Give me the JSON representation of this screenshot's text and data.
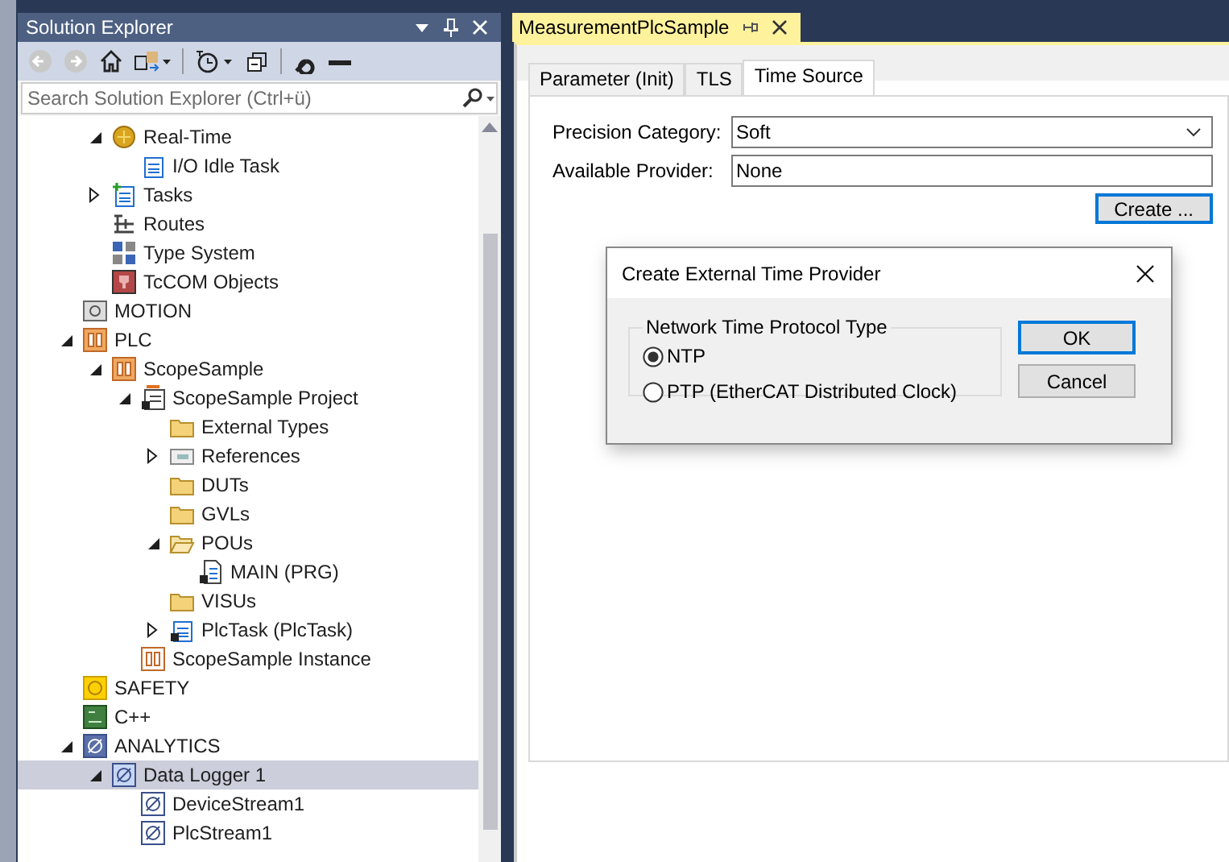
{
  "solution_explorer": {
    "title": "Solution Explorer",
    "search": {
      "placeholder": "Search Solution Explorer (Ctrl+ü)"
    },
    "tree": {
      "scrolled_items": [
        {
          "label": "Real-Time",
          "kind": "realtime",
          "expanded": true,
          "selected": false,
          "children": [
            {
              "label": "I/O Idle Task",
              "kind": "task",
              "selected": false
            }
          ]
        },
        {
          "label": "Tasks",
          "kind": "tasks",
          "expanded": false,
          "selected": false
        },
        {
          "label": "Routes",
          "kind": "routes",
          "selected": false
        },
        {
          "label": "Type System",
          "kind": "types",
          "selected": false
        },
        {
          "label": "TcCOM Objects",
          "kind": "tccom",
          "selected": false
        }
      ],
      "items": [
        {
          "label": "MOTION",
          "kind": "motion",
          "selected": false
        },
        {
          "label": "PLC",
          "kind": "plc",
          "expanded": true,
          "selected": false,
          "children": [
            {
              "label": "ScopeSample",
              "kind": "plc",
              "expanded": true,
              "selected": false,
              "children": [
                {
                  "label": "ScopeSample Project",
                  "kind": "project",
                  "expanded": true,
                  "selected": false,
                  "children": [
                    {
                      "label": "External Types",
                      "kind": "folder",
                      "selected": false
                    },
                    {
                      "label": "References",
                      "kind": "references",
                      "expanded": false,
                      "selected": false
                    },
                    {
                      "label": "DUTs",
                      "kind": "folder",
                      "selected": false
                    },
                    {
                      "label": "GVLs",
                      "kind": "folder",
                      "selected": false
                    },
                    {
                      "label": "POUs",
                      "kind": "folder-open",
                      "expanded": true,
                      "selected": false,
                      "children": [
                        {
                          "label": "MAIN (PRG)",
                          "kind": "pou",
                          "selected": false
                        }
                      ]
                    },
                    {
                      "label": "VISUs",
                      "kind": "folder",
                      "selected": false
                    },
                    {
                      "label": "PlcTask (PlcTask)",
                      "kind": "plctask",
                      "expanded": false,
                      "selected": false
                    }
                  ]
                },
                {
                  "label": "ScopeSample Instance",
                  "kind": "instance",
                  "selected": false
                }
              ]
            }
          ]
        },
        {
          "label": "SAFETY",
          "kind": "safety",
          "selected": false
        },
        {
          "label": "C++",
          "kind": "cpp",
          "selected": false
        },
        {
          "label": "ANALYTICS",
          "kind": "analytics",
          "expanded": true,
          "selected": false,
          "children": [
            {
              "label": "Data Logger 1",
              "kind": "logger",
              "expanded": true,
              "selected": true,
              "children": [
                {
                  "label": "DeviceStream1",
                  "kind": "stream",
                  "selected": false
                },
                {
                  "label": "PlcStream1",
                  "kind": "stream",
                  "selected": false
                }
              ]
            }
          ]
        }
      ]
    }
  },
  "document": {
    "tab": {
      "label": "MeasurementPlcSample",
      "selected": true
    },
    "tabs": [
      {
        "label": "Parameter (Init)",
        "selected": false
      },
      {
        "label": "TLS",
        "selected": false
      },
      {
        "label": "Time Source",
        "selected": true
      }
    ],
    "fields": [
      {
        "label": "Precision Category:",
        "value": "Soft",
        "kind": "combo"
      },
      {
        "label": "Available Provider:",
        "value": "None",
        "kind": "text"
      }
    ],
    "create_button": "Create ..."
  },
  "dialog": {
    "title": "Create External Time Provider",
    "group": "Network Time Protocol Type",
    "options": [
      {
        "label": "NTP",
        "selected": true
      },
      {
        "label": "PTP (EtherCAT Distributed Clock)",
        "selected": false
      }
    ],
    "buttons": [
      {
        "label": "OK",
        "default": true
      },
      {
        "label": "Cancel",
        "default": false
      }
    ]
  }
}
